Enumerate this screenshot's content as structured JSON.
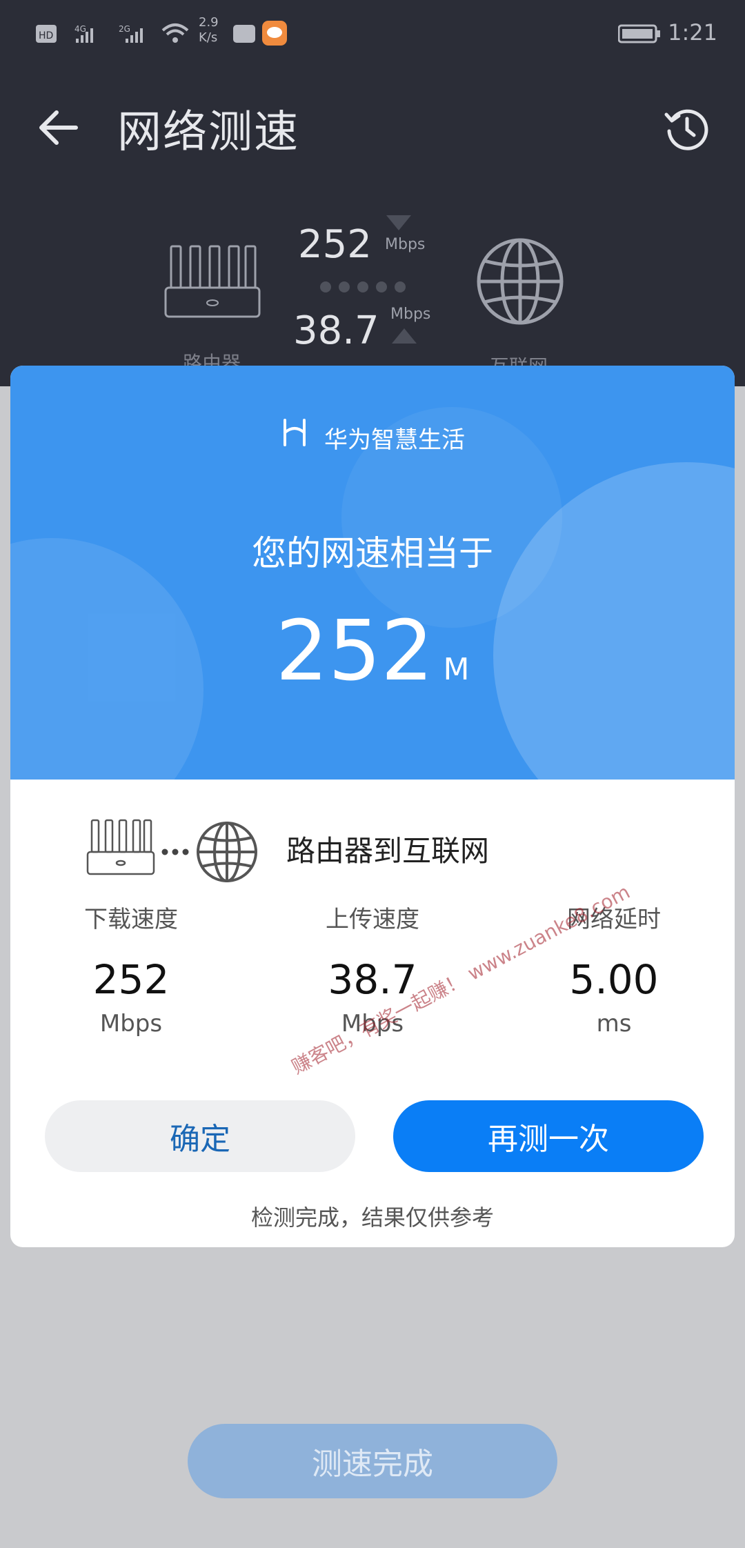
{
  "status_bar": {
    "network_speed": "2.9\nK/s",
    "time": "1:21",
    "icons": [
      "hd-icon",
      "signal-4g-icon",
      "signal-2g-icon",
      "wifi-icon",
      "message-app-icon",
      "battery-icon"
    ]
  },
  "header": {
    "title": "网络测速",
    "back_icon": "back-arrow-icon",
    "history_icon": "history-clock-icon"
  },
  "speed_panel": {
    "download_value": "252",
    "download_unit": "Mbps",
    "upload_value": "38.7",
    "upload_unit": "Mbps",
    "router_label": "路由器",
    "internet_label": "互联网"
  },
  "dialog": {
    "brand": "华为智慧生活",
    "subtitle": "您的网速相当于",
    "speed_value": "252",
    "speed_unit": "M",
    "route_label": "路由器到互联网",
    "metrics": [
      {
        "label": "下载速度",
        "value": "252",
        "unit": "Mbps"
      },
      {
        "label": "上传速度",
        "value": "38.7",
        "unit": "Mbps"
      },
      {
        "label": "网络延时",
        "value": "5.00",
        "unit": "ms"
      }
    ],
    "confirm_label": "确定",
    "retest_label": "再测一次",
    "footer_note": "检测完成，结果仅供参考"
  },
  "watermark": "赚客吧，有奖一起赚！ www.zuanke8.com",
  "bottom_button": "测速完成",
  "colors": {
    "accent": "#0a7ef6",
    "hero_blue": "#3d95ef",
    "dark_bg": "#2b2d37"
  }
}
